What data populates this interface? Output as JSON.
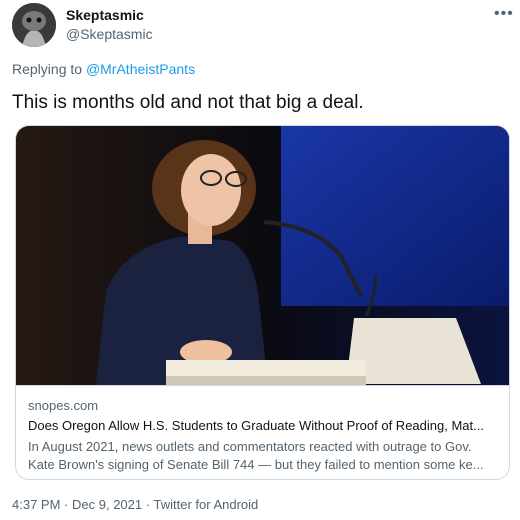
{
  "author": {
    "display_name": "Skeptasmic",
    "handle": "@Skeptasmic",
    "avatar_icon": "avatar-photo"
  },
  "more_icon": "more-horizontal-icon",
  "reply": {
    "prefix": "Replying to",
    "to": "@MrAtheistPants"
  },
  "tweet": {
    "text": "This is months old and not that big a deal."
  },
  "link_card": {
    "image_alt": "woman-speaking-at-podium-photo",
    "domain": "snopes.com",
    "title": "Does Oregon Allow H.S. Students to Graduate Without Proof of Reading, Mat...",
    "description_line1": "In August 2021, news outlets and commentators reacted with outrage to Gov.",
    "description_line2": "Kate Brown's signing of Senate Bill 744 — but they failed to mention some ke..."
  },
  "meta": {
    "time": "4:37 PM",
    "date": "Dec 9, 2021",
    "source": "Twitter for Android",
    "separator": "·"
  },
  "colors": {
    "link": "#1d9bf0",
    "muted": "#536471",
    "text": "#0f1419",
    "border": "#cfd9de"
  }
}
